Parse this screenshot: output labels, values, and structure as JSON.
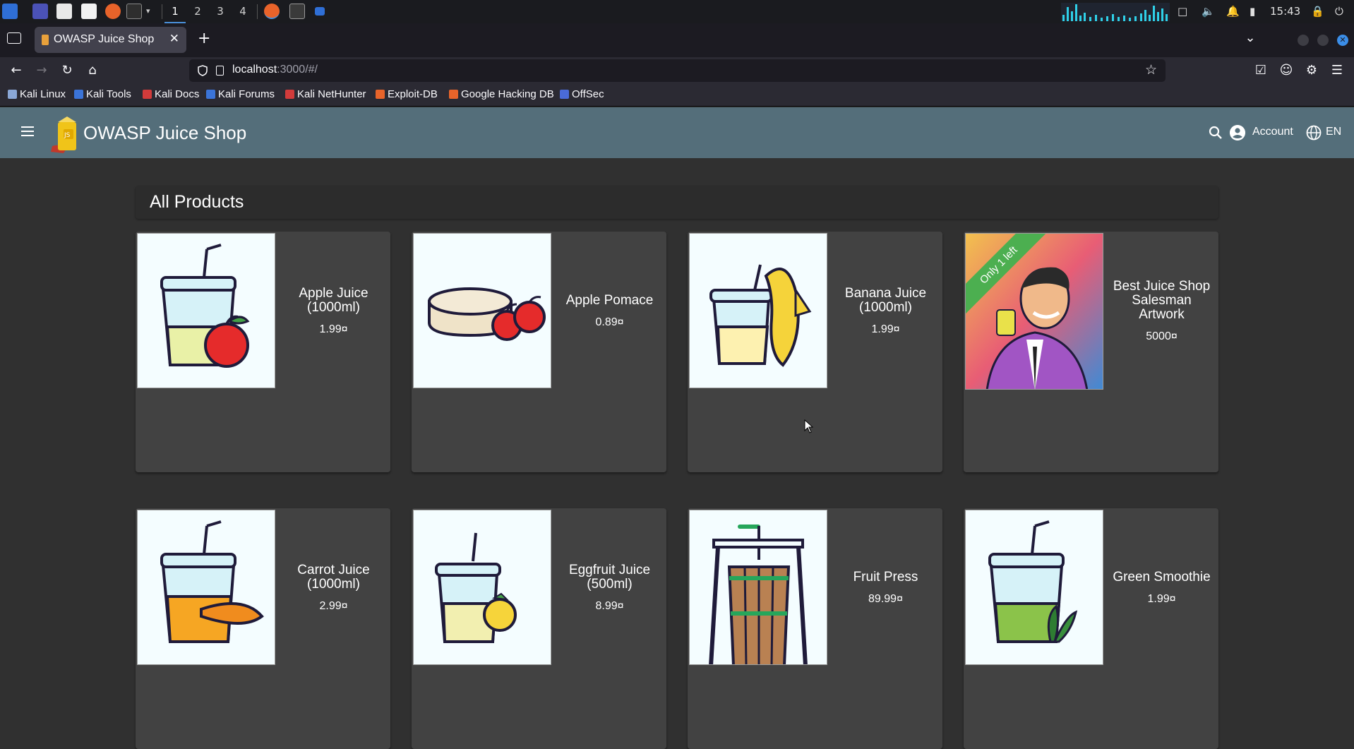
{
  "taskbar": {
    "workspaces": [
      "1",
      "2",
      "3",
      "4"
    ],
    "clock": "15:43"
  },
  "browser": {
    "tab_title": "OWASP Juice Shop",
    "url_host": "localhost",
    "url_path": ":3000/#/",
    "bookmarks": [
      {
        "label": "Kali Linux",
        "icon": "kali-icon"
      },
      {
        "label": "Kali Tools",
        "icon": "kali-tools-icon"
      },
      {
        "label": "Kali Docs",
        "icon": "kali-docs-icon"
      },
      {
        "label": "Kali Forums",
        "icon": "kali-forums-icon"
      },
      {
        "label": "Kali NetHunter",
        "icon": "nethunter-icon"
      },
      {
        "label": "Exploit-DB",
        "icon": "exploit-db-icon"
      },
      {
        "label": "Google Hacking DB",
        "icon": "ghdb-icon"
      },
      {
        "label": "OffSec",
        "icon": "offsec-icon"
      }
    ]
  },
  "app": {
    "title": "OWASP Juice Shop",
    "account_label": "Account",
    "language_label": "EN",
    "toolbar_color": "#546e7a"
  },
  "main": {
    "heading": "All Products",
    "products": [
      {
        "name": "Apple Juice (1000ml)",
        "price": "1.99¤",
        "image": "apple-juice"
      },
      {
        "name": "Apple Pomace",
        "price": "0.89¤",
        "image": "apple-pomace"
      },
      {
        "name": "Banana Juice (1000ml)",
        "price": "1.99¤",
        "image": "banana-juice"
      },
      {
        "name": "Best Juice Shop Salesman Artwork",
        "price": "5000¤",
        "image": "salesman-artwork",
        "ribbon": "Only 1 left"
      },
      {
        "name": "Carrot Juice (1000ml)",
        "price": "2.99¤",
        "image": "carrot-juice"
      },
      {
        "name": "Eggfruit Juice (500ml)",
        "price": "8.99¤",
        "image": "eggfruit-juice"
      },
      {
        "name": "Fruit Press",
        "price": "89.99¤",
        "image": "fruit-press"
      },
      {
        "name": "Green Smoothie",
        "price": "1.99¤",
        "image": "green-smoothie"
      }
    ]
  }
}
